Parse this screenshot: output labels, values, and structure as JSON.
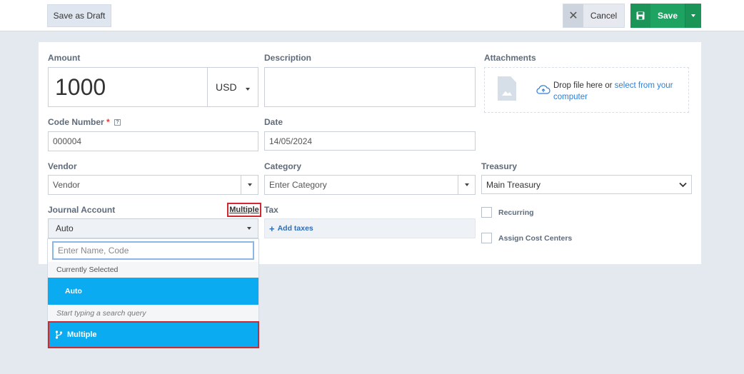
{
  "toolbar": {
    "save_draft_label": "Save as Draft",
    "cancel_label": "Cancel",
    "save_label": "Save"
  },
  "form": {
    "amount": {
      "label": "Amount",
      "value": "1000",
      "currency": "USD"
    },
    "description": {
      "label": "Description",
      "value": ""
    },
    "attachments": {
      "label": "Attachments",
      "drop_text": "Drop file here or ",
      "link_text": "select from your computer"
    },
    "code_number": {
      "label": "Code Number",
      "required_mark": "*",
      "help_mark": "?",
      "value": "000004"
    },
    "date": {
      "label": "Date",
      "value": "14/05/2024"
    },
    "vendor": {
      "label": "Vendor",
      "placeholder": "Vendor"
    },
    "category": {
      "label": "Category",
      "placeholder": "Enter Category"
    },
    "treasury": {
      "label": "Treasury",
      "value": "Main Treasury"
    },
    "journal_account": {
      "label": "Journal Account",
      "multiple_link": "Multiple",
      "value": "Auto"
    },
    "tax": {
      "label": "Tax",
      "add_label": "Add taxes"
    },
    "recurring_label": "Recurring",
    "cost_centers_label": "Assign Cost Centers"
  },
  "dropdown": {
    "search_placeholder": "Enter Name, Code",
    "currently_selected_label": "Currently Selected",
    "selected_item": "Auto",
    "hint": "Start typing a search query",
    "multiple_option": "Multiple"
  },
  "colors": {
    "save_green": "#1ea362",
    "highlight_blue": "#0aabf0",
    "annotation_red": "#d0292f",
    "link_blue": "#2c7fd8"
  }
}
